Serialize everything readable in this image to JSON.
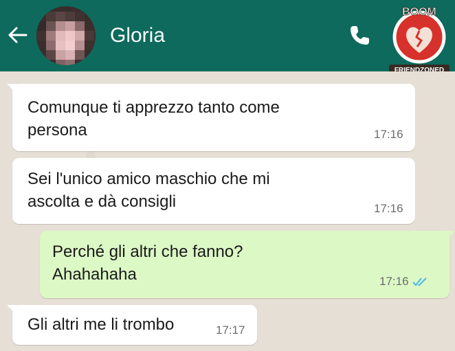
{
  "header": {
    "contact_name": "Gloria",
    "back_icon": "back-arrow-icon",
    "call_icon": "phone-icon",
    "badge": {
      "top_text": "BOOM",
      "bottom_text": "FRIENDZONED"
    },
    "colors": {
      "header_bg": "#0d6a5c",
      "badge_red": "#d6322b"
    }
  },
  "messages": [
    {
      "direction": "in",
      "text_lines": [
        "Comunque ti apprezzo tanto come",
        "persona"
      ],
      "time": "17:16"
    },
    {
      "direction": "in",
      "text_lines": [
        "Sei l'unico amico maschio che mi",
        "ascolta e dà consigli"
      ],
      "time": "17:16"
    },
    {
      "direction": "out",
      "text_lines": [
        "Perché gli altri che fanno?",
        "Ahahahaha"
      ],
      "time": "17:16",
      "status": "read"
    },
    {
      "direction": "in",
      "text_lines": [
        "Gli altri me li trombo"
      ],
      "time": "17:17"
    }
  ],
  "colors": {
    "incoming_bubble": "#ffffff",
    "outgoing_bubble": "#dcf8c5",
    "read_ticks": "#4fb6e8",
    "chat_bg": "#e6dfd6"
  }
}
